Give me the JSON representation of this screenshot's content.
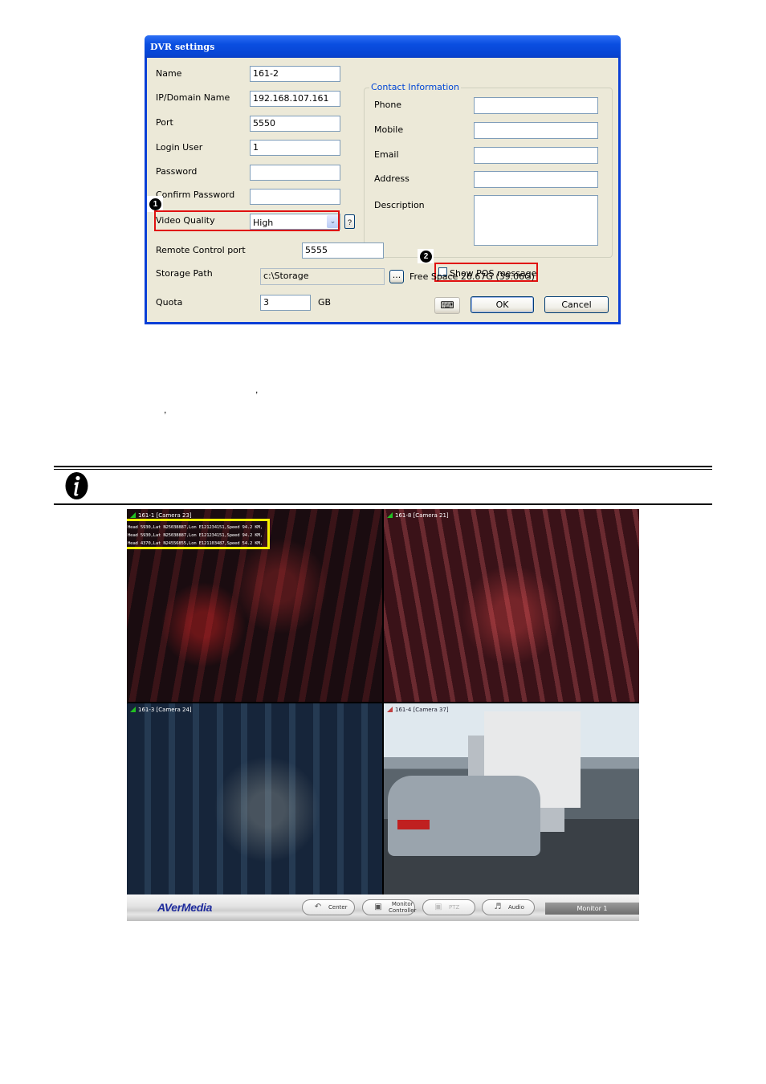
{
  "dialog": {
    "title": "DVR settings",
    "fields": {
      "name": {
        "label": "Name",
        "value": "161-2"
      },
      "ip": {
        "label": "IP/Domain Name",
        "value": "192.168.107.161"
      },
      "port": {
        "label": "Port",
        "value": "5550"
      },
      "login_user": {
        "label": "Login User",
        "value": "1"
      },
      "password": {
        "label": "Password",
        "value": ""
      },
      "confirm_password": {
        "label": "Confirm Password",
        "value": ""
      },
      "video_quality": {
        "label": "Video Quality",
        "value": "High",
        "help": "?"
      },
      "remote_control_port": {
        "label": "Remote Control port",
        "value": "5555"
      },
      "storage_path": {
        "label": "Storage Path",
        "value": "c:\\Storage",
        "browse": "..."
      },
      "free_space": "Free Space 26.67G (39.06G)",
      "quota": {
        "label": "Quota",
        "value": "3",
        "unit": "GB"
      }
    },
    "contact": {
      "legend": "Contact Information",
      "phone": {
        "label": "Phone",
        "value": ""
      },
      "mobile": {
        "label": "Mobile",
        "value": ""
      },
      "email": {
        "label": "Email",
        "value": ""
      },
      "address": {
        "label": "Address",
        "value": ""
      },
      "description": {
        "label": "Description",
        "value": ""
      }
    },
    "show_pos": {
      "label": "Show POS message",
      "checked": false
    },
    "buttons": {
      "ok": "OK",
      "cancel": "Cancel"
    },
    "callouts": {
      "one": "1",
      "two": "2"
    },
    "highlight_color": "#e01010"
  },
  "note": {
    "text_fragments": [
      ",",
      ","
    ],
    "icon": "info-icon"
  },
  "cameras": [
    {
      "label": "161-1 [Camera 23]",
      "pos_lines": [
        "Head 5930,Lat N25038887,Lon E121234151,Speed 94.2 KM,",
        "Head 5930,Lat N25038887,Lon E121234151,Speed 94.2 KM,",
        "Head 4370,Lat N24556855,Lon E121103487,Speed 54.2 KM,"
      ]
    },
    {
      "label": "161-8 [Camera 21]"
    },
    {
      "label": "161-3 [Camera 24]"
    },
    {
      "label": "161-4 [Camera 37]"
    }
  ],
  "toolbar": {
    "brand": "AVerMedia",
    "center": "Center",
    "monitor_controller_1": "Monitor",
    "monitor_controller_2": "Controller",
    "ptz": "PTZ",
    "audio": "Audio",
    "monitor": "Monitor 1"
  },
  "pos_highlight_color": "#f5f200"
}
